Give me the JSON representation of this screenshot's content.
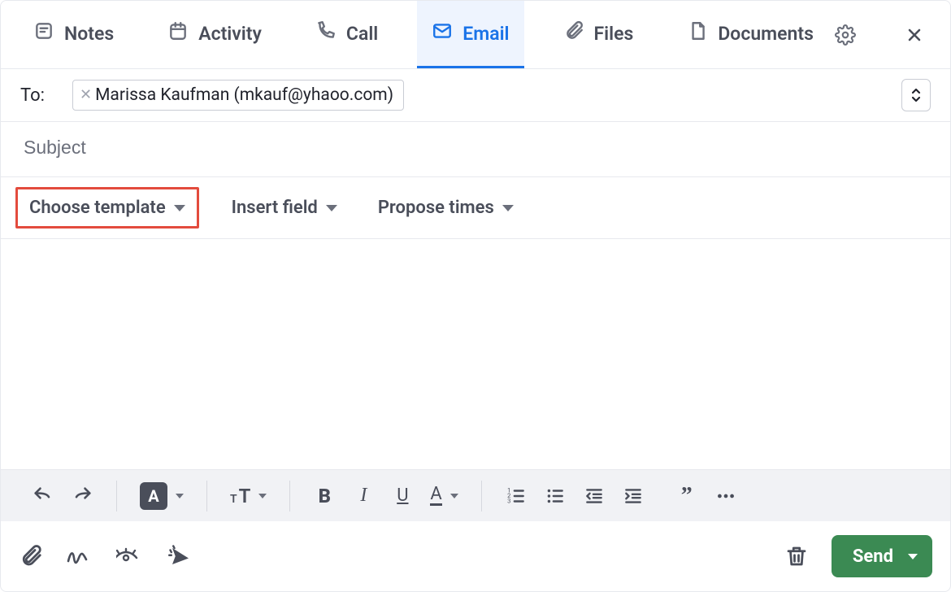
{
  "tabs": {
    "notes": "Notes",
    "activity": "Activity",
    "call": "Call",
    "email": "Email",
    "files": "Files",
    "documents": "Documents",
    "active": "email"
  },
  "to": {
    "label": "To:",
    "recipient": "Marissa Kaufman (mkauf@yhaoo.com)"
  },
  "subject": {
    "placeholder": "Subject",
    "value": ""
  },
  "mid": {
    "choose_template": "Choose template",
    "insert_field": "Insert field",
    "propose_times": "Propose times"
  },
  "send": {
    "label": "Send"
  }
}
